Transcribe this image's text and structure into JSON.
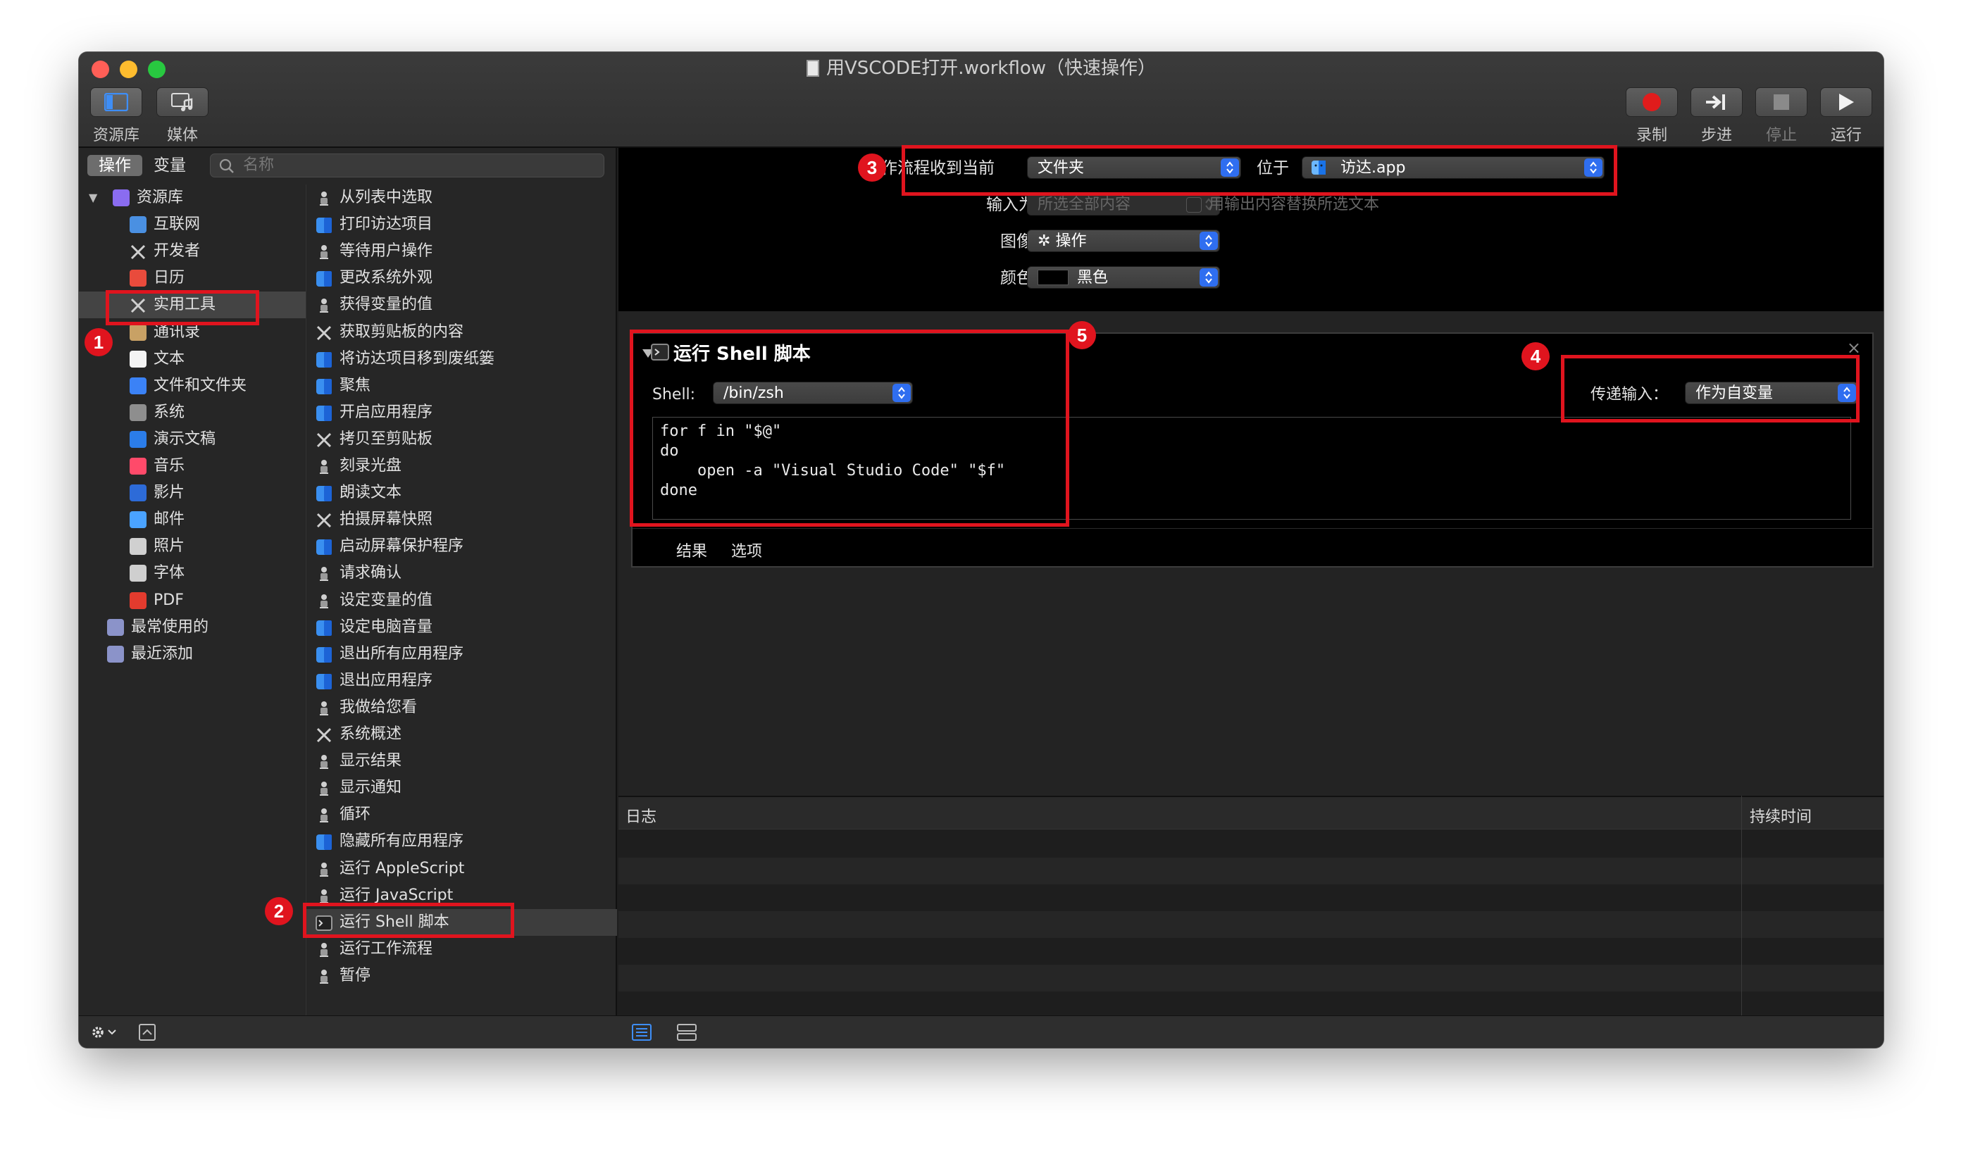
{
  "window": {
    "title": "用VSCODE打开.workflow（快速操作）"
  },
  "toolbar": {
    "library": "资源库",
    "media": "媒体",
    "record": "录制",
    "step": "步进",
    "stop": "停止",
    "run": "运行"
  },
  "library": {
    "seg_actions": "操作",
    "seg_variables": "变量",
    "search_placeholder": "名称",
    "categories": [
      {
        "label": "资源库"
      },
      {
        "label": "互联网"
      },
      {
        "label": "开发者"
      },
      {
        "label": "日历"
      },
      {
        "label": "实用工具"
      },
      {
        "label": "通讯录"
      },
      {
        "label": "文本"
      },
      {
        "label": "文件和文件夹"
      },
      {
        "label": "系统"
      },
      {
        "label": "演示文稿"
      },
      {
        "label": "音乐"
      },
      {
        "label": "影片"
      },
      {
        "label": "邮件"
      },
      {
        "label": "照片"
      },
      {
        "label": "字体"
      },
      {
        "label": "PDF"
      },
      {
        "label": "最常使用的"
      },
      {
        "label": "最近添加"
      }
    ],
    "actions": [
      {
        "label": "从列表中选取"
      },
      {
        "label": "打印访达项目"
      },
      {
        "label": "等待用户操作"
      },
      {
        "label": "更改系统外观"
      },
      {
        "label": "获得变量的值"
      },
      {
        "label": "获取剪贴板的内容"
      },
      {
        "label": "将访达项目移到废纸篓"
      },
      {
        "label": "聚焦"
      },
      {
        "label": "开启应用程序"
      },
      {
        "label": "拷贝至剪贴板"
      },
      {
        "label": "刻录光盘"
      },
      {
        "label": "朗读文本"
      },
      {
        "label": "拍摄屏幕快照"
      },
      {
        "label": "启动屏幕保护程序"
      },
      {
        "label": "请求确认"
      },
      {
        "label": "设定变量的值"
      },
      {
        "label": "设定电脑音量"
      },
      {
        "label": "退出所有应用程序"
      },
      {
        "label": "退出应用程序"
      },
      {
        "label": "我做给您看"
      },
      {
        "label": "系统概述"
      },
      {
        "label": "显示结果"
      },
      {
        "label": "显示通知"
      },
      {
        "label": "循环"
      },
      {
        "label": "隐藏所有应用程序"
      },
      {
        "label": "运行 AppleScript"
      },
      {
        "label": "运行 JavaScript"
      },
      {
        "label": "运行 Shell 脚本"
      },
      {
        "label": "运行工作流程"
      },
      {
        "label": "暂停"
      }
    ]
  },
  "receive": {
    "label_receives": "工作流程收到当前",
    "receives_value": "文件夹",
    "label_in": "位于",
    "in_value": "访达.app",
    "label_input_is": "输入为",
    "input_is_value": "所选全部内容",
    "replace_label": "用输出内容替换所选文本",
    "label_image": "图像",
    "image_value": "操作",
    "label_color": "颜色",
    "color_value": "黑色"
  },
  "shell_action": {
    "title": "运行 Shell 脚本",
    "shell_label": "Shell:",
    "shell_value": "/bin/zsh",
    "pass_input_label": "传递输入：",
    "pass_input_value": "作为自变量",
    "code": "for f in \"$@\"\ndo\n    open -a \"Visual Studio Code\" \"$f\"\ndone",
    "tab_results": "结果",
    "tab_options": "选项"
  },
  "log": {
    "col_log": "日志",
    "col_duration": "持续时间"
  },
  "annotations": [
    "1",
    "2",
    "3",
    "4",
    "5"
  ],
  "colors": {
    "annotation": "#e0141e",
    "stepper": "#2f6ef0",
    "record": "#e01c1c"
  }
}
